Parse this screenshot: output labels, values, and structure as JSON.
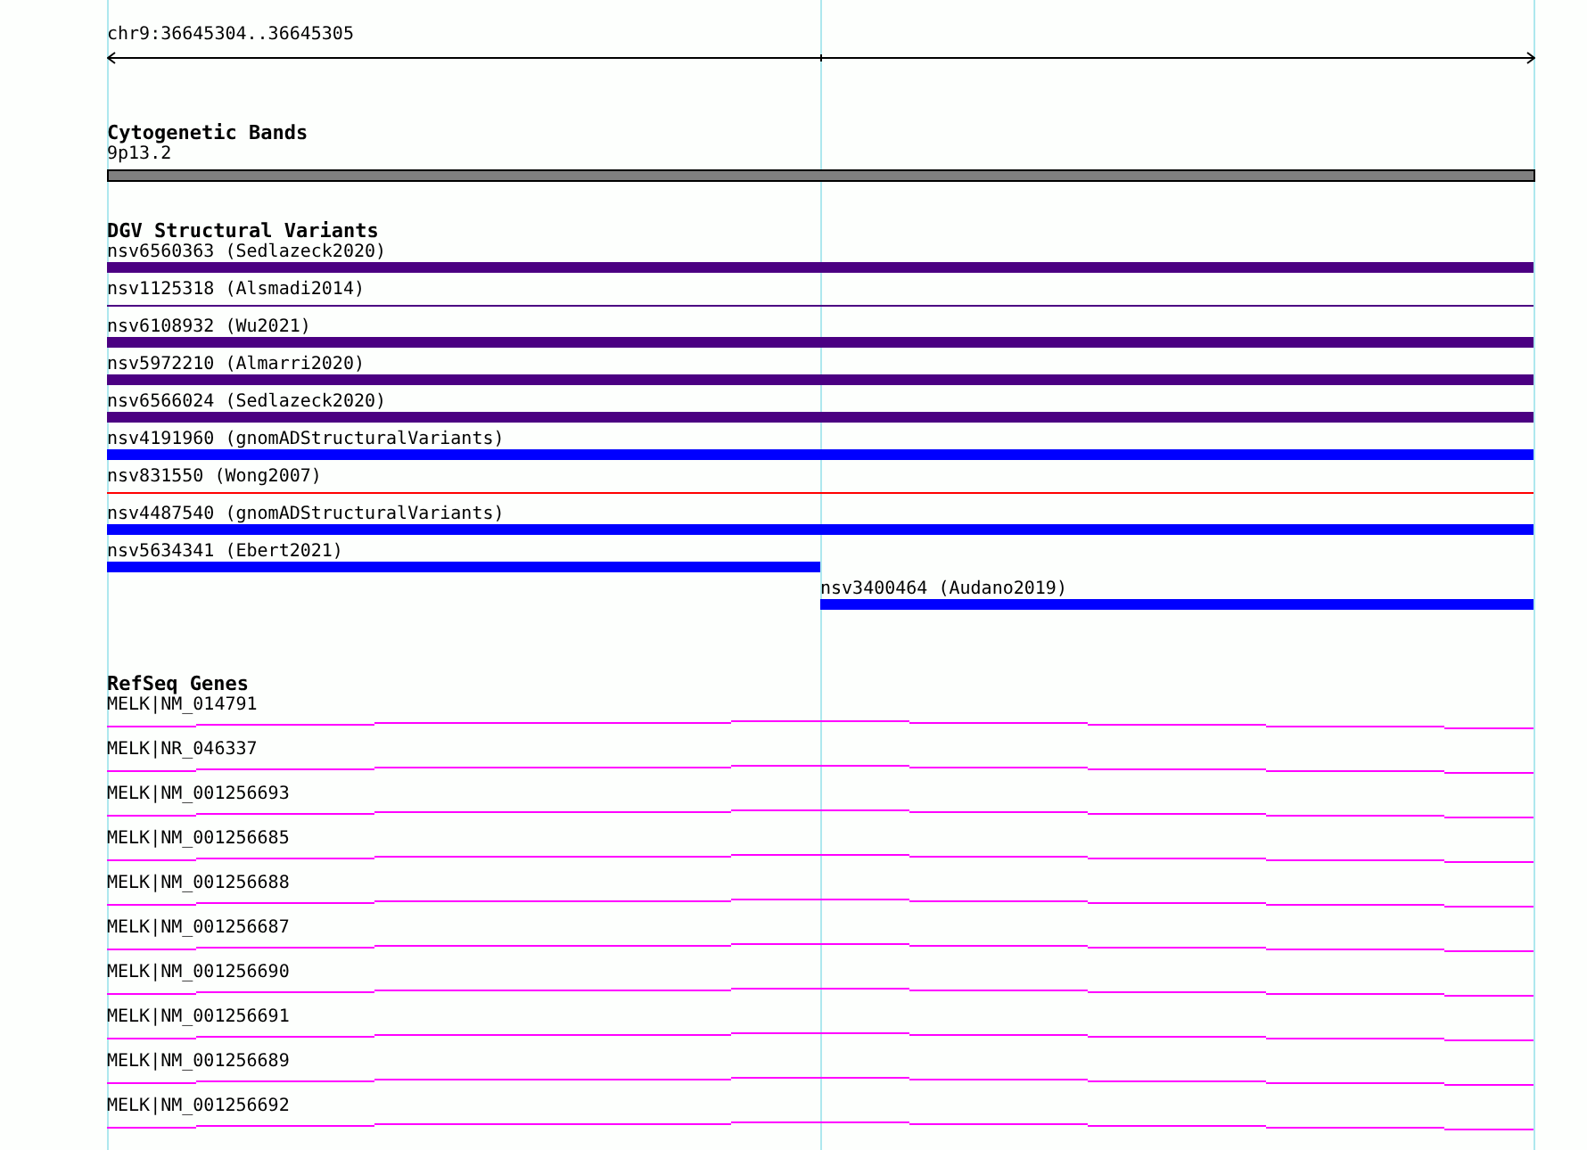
{
  "location": "chr9:36645304..36645305",
  "cytogenetic_bands": {
    "title": "Cytogenetic Bands",
    "bands": [
      {
        "label": "9p13.2",
        "color": "#808080"
      }
    ]
  },
  "dgv": {
    "title": "DGV Structural Variants",
    "variants": [
      {
        "label": "nsv6560363 (Sedlazeck2020)",
        "kind": "thick",
        "color": "#4b0082",
        "reaches_start": true,
        "reaches_end": true
      },
      {
        "label": "nsv1125318 (Alsmadi2014)",
        "kind": "thin",
        "color": "#4b0082",
        "reaches_start": true,
        "reaches_end": true
      },
      {
        "label": "nsv6108932 (Wu2021)",
        "kind": "thick",
        "color": "#4b0082",
        "reaches_start": true,
        "reaches_end": true
      },
      {
        "label": "nsv5972210 (Almarri2020)",
        "kind": "thick",
        "color": "#4b0082",
        "reaches_start": true,
        "reaches_end": true
      },
      {
        "label": "nsv6566024 (Sedlazeck2020)",
        "kind": "thick",
        "color": "#4b0082",
        "reaches_start": true,
        "reaches_end": true
      },
      {
        "label": "nsv4191960 (gnomADStructuralVariants)",
        "kind": "thick",
        "color": "#0000ff",
        "reaches_start": true,
        "reaches_end": true
      },
      {
        "label": "nsv831550 (Wong2007)",
        "kind": "thin",
        "color": "#ff0000",
        "reaches_start": true,
        "reaches_end": true
      },
      {
        "label": "nsv4487540 (gnomADStructuralVariants)",
        "kind": "thick",
        "color": "#0000ff",
        "reaches_start": true,
        "reaches_end": true
      },
      {
        "label": "nsv5634341 (Ebert2021)",
        "kind": "thick",
        "color": "#0000ff",
        "reaches_start": true,
        "reaches_end": false
      },
      {
        "label": "nsv3400464 (Audano2019)",
        "kind": "thick",
        "color": "#0000ff",
        "reaches_start": false,
        "reaches_end": true
      }
    ]
  },
  "refseq": {
    "title": "RefSeq Genes",
    "genes": [
      {
        "label": "MELK|NM_014791"
      },
      {
        "label": "MELK|NR_046337"
      },
      {
        "label": "MELK|NM_001256693"
      },
      {
        "label": "MELK|NM_001256685"
      },
      {
        "label": "MELK|NM_001256688"
      },
      {
        "label": "MELK|NM_001256687"
      },
      {
        "label": "MELK|NM_001256690"
      },
      {
        "label": "MELK|NM_001256691"
      },
      {
        "label": "MELK|NM_001256689"
      },
      {
        "label": "MELK|NM_001256692"
      }
    ]
  }
}
